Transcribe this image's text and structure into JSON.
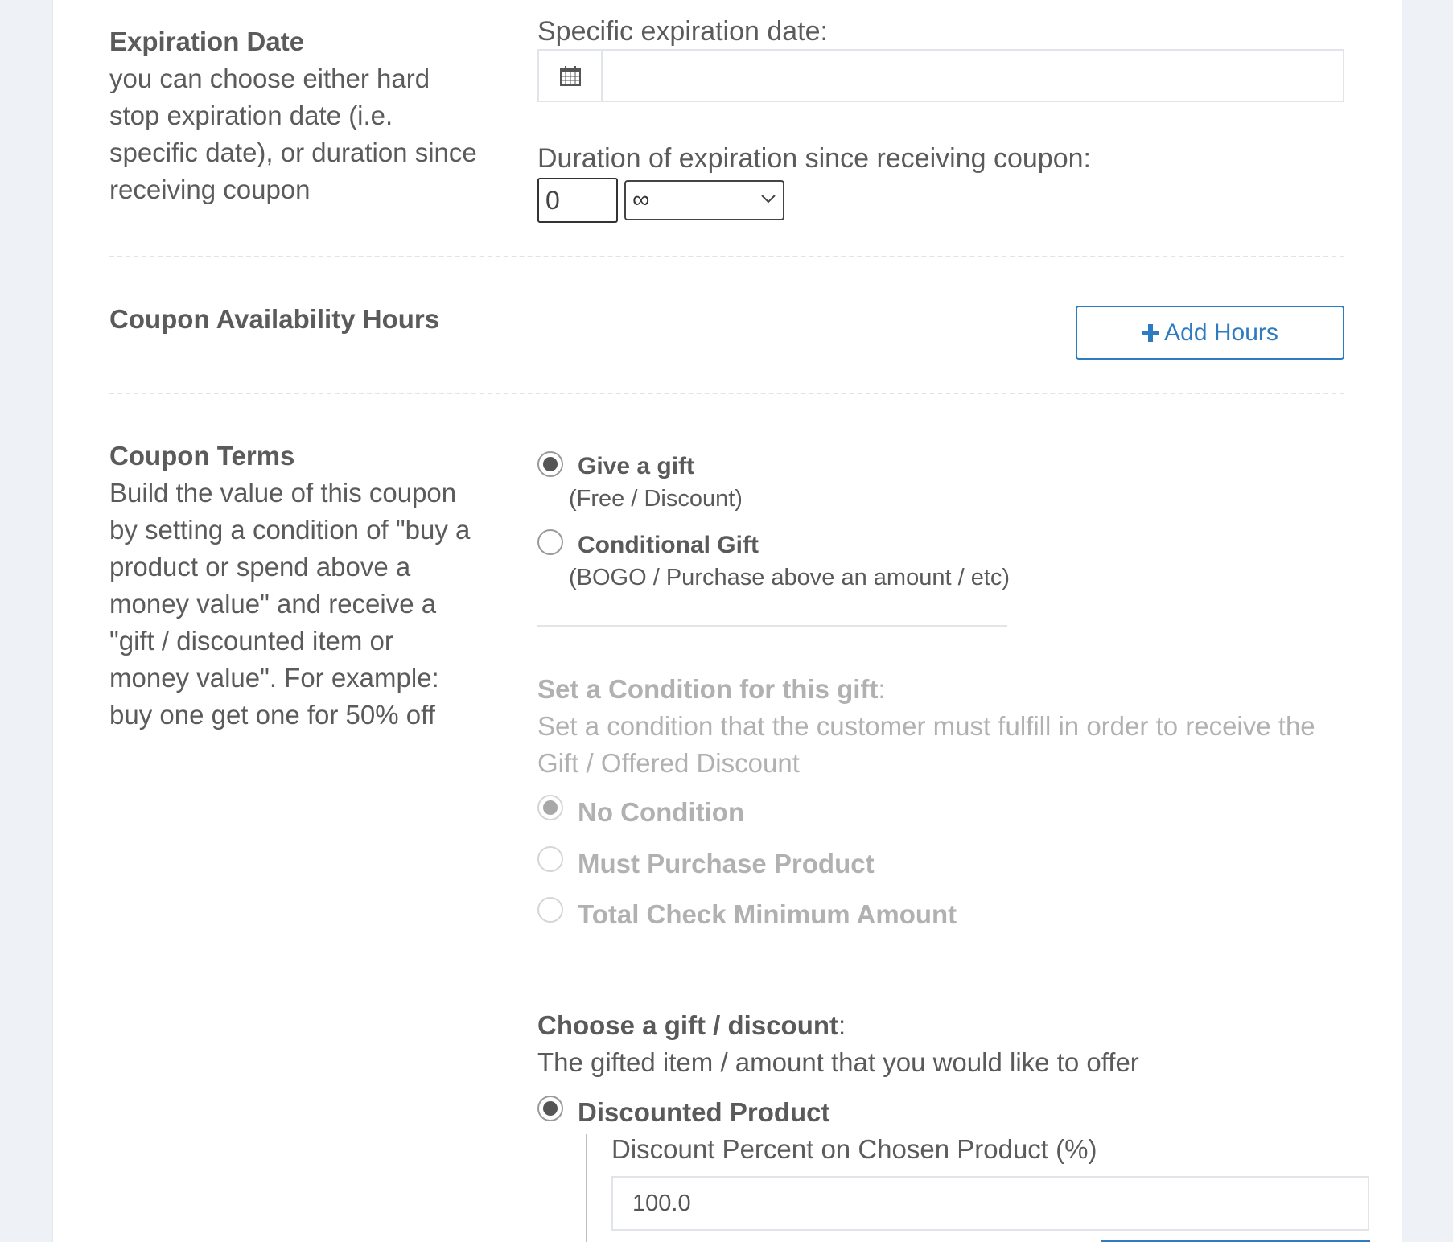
{
  "expiration": {
    "title": "Expiration Date",
    "desc_lines": [
      "you can choose either hard",
      "stop expiration date (i.e.",
      "specific date), or duration since",
      "receiving coupon"
    ],
    "specific_label": "Specific expiration date:",
    "specific_value": "",
    "duration_label": "Duration of expiration since receiving coupon:",
    "duration_value": "0",
    "duration_unit": "∞"
  },
  "availability": {
    "title": "Coupon Availability Hours",
    "add_hours_label": "Add Hours"
  },
  "terms": {
    "title": "Coupon Terms",
    "desc_lines": [
      "Build the value of this coupon",
      "by setting a condition of \"buy a",
      "product or spend above a",
      "money value\" and receive a",
      "\"gift / discounted item or",
      "money value\". For example:",
      "buy one get one for 50% off"
    ],
    "gift_types": [
      {
        "title": "Give a gift",
        "sub": "(Free / Discount)",
        "selected": true
      },
      {
        "title": "Conditional Gift",
        "sub": "(BOGO / Purchase above an amount / etc)",
        "selected": false
      }
    ],
    "condition": {
      "heading": "Set a Condition for this gift",
      "colon": ":",
      "desc_lines": [
        "Set a condition that the customer must fulfill in order to receive the",
        "Gift / Offered Discount"
      ],
      "options": [
        {
          "label": "No Condition",
          "selected": true
        },
        {
          "label": "Must Purchase Product",
          "selected": false
        },
        {
          "label": "Total Check Minimum Amount",
          "selected": false
        }
      ]
    },
    "gift": {
      "heading": "Choose a gift / discount",
      "colon": ":",
      "desc": "The gifted item / amount that you would like to offer",
      "option_label": "Discounted Product",
      "percent_label": "Discount Percent on Chosen Product (%)",
      "percent_value": "100.0"
    }
  },
  "colors": {
    "accent": "#2f7bbf",
    "text": "#5a5a5a",
    "muted": "#b1b1b1"
  }
}
